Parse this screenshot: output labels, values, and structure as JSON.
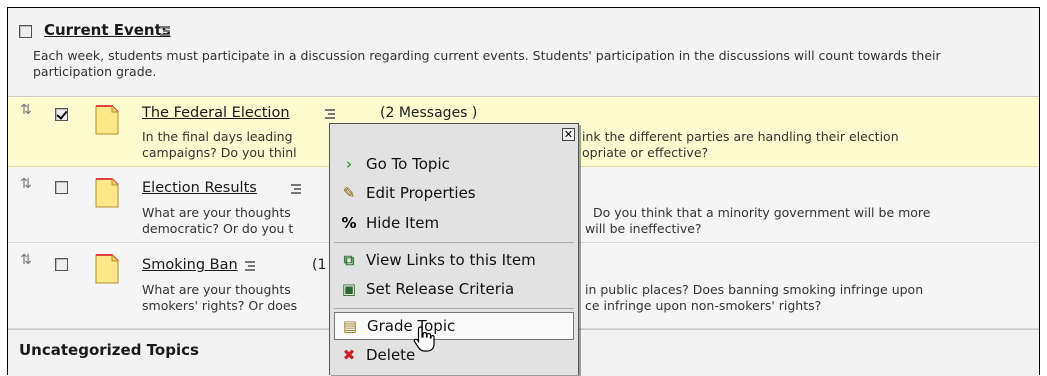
{
  "category": {
    "title": "Current Events",
    "description": "Each week, students must participate in a discussion regarding current events. Students' participation in the discussions will count towards their participation grade."
  },
  "topics": [
    {
      "title": "The Federal Election",
      "messages": "(2 Messages )",
      "desc_line1": "In the final days leading",
      "desc_line1_end": "ink the different parties are handling their election",
      "desc_line2": "campaigns? Do you thinl",
      "desc_line2_end": "opriate or effective?",
      "checked": true
    },
    {
      "title": "Election Results",
      "desc_line1": "What are your thoughts",
      "desc_line1_end": "Do you think that a minority government will be more",
      "desc_line2": "democratic? Or do you t",
      "desc_line2_end": "will be ineffective?",
      "checked": false
    },
    {
      "title": "Smoking Ban",
      "messages": "(1",
      "desc_line1": "What are your thoughts",
      "desc_line1_end": "in public places? Does banning smoking infringe upon",
      "desc_line2": "smokers' rights? Or does",
      "desc_line2_end": "ce infringe upon non-smokers' rights?",
      "checked": false
    }
  ],
  "uncategorized": {
    "title": "Uncategorized Topics"
  },
  "context_menu": {
    "close": "✕",
    "items": [
      {
        "label": "Go To Topic",
        "icon": "go-arrow-icon"
      },
      {
        "label": "Edit Properties",
        "icon": "pencil-icon"
      },
      {
        "label": "Hide Item",
        "icon": "hide-icon"
      },
      {
        "label": "View Links to this Item",
        "icon": "links-icon"
      },
      {
        "label": "Set Release Criteria",
        "icon": "release-criteria-icon"
      },
      {
        "label": "Grade Topic",
        "icon": "grade-icon",
        "hovered": true
      },
      {
        "label": "Delete",
        "icon": "delete-x-icon"
      }
    ]
  },
  "colors": {
    "highlight_row": "#fefbd0",
    "go_arrow": "#3a9a3a",
    "delete_red": "#cc2222"
  }
}
